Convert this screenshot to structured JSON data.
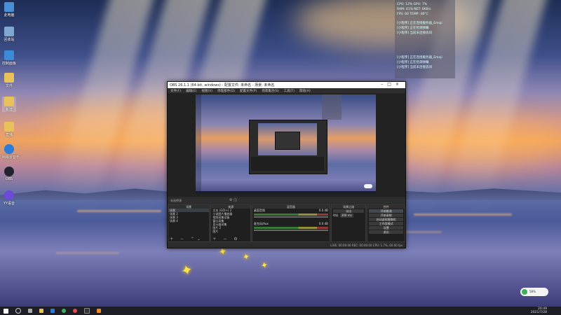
{
  "desktop": {
    "icons": [
      {
        "label": "此电脑",
        "color": "#4a8fd6"
      },
      {
        "label": "回收站",
        "color": "#7fa7cf"
      },
      {
        "label": "控制面板",
        "color": "#3d8ad8"
      },
      {
        "label": "文件",
        "color": "#e8c15a"
      },
      {
        "label": "新建",
        "color": "#e8c15a"
      },
      {
        "label": "直播",
        "color": "#e8c15a"
      },
      {
        "label": "网易云音乐",
        "color": "#2b7bd8"
      },
      {
        "label": "OBS",
        "color": "#222233"
      },
      {
        "label": "YY语音",
        "color": "#6b4bd8"
      }
    ]
  },
  "monitor": {
    "rows": [
      "CPU: 12%  GPU: 7%",
      "RAM: 41%  NET: 6KB/s",
      "FPS: 60  TEMP: 48°C",
      "[小程序] 正在连接服务器_Emoji",
      "[小程序] 正在检测弹幕",
      "[小程序] 当前未连接房间",
      "[小程序] 正在连接服务器_Emoji",
      "[小程序] 正在检测弹幕",
      "[小程序] 当前未连接房间"
    ]
  },
  "obs": {
    "title": "OBS 26.1.1 (64-bit, windows) - 配置文件: 未命名 - 场景: 未命名",
    "menu": [
      "文件(F)",
      "编辑(E)",
      "视图(V)",
      "停靠部件(D)",
      "配置文件(P)",
      "场景集合(S)",
      "工具(T)",
      "帮助(H)"
    ],
    "scene_bar": "未选择源",
    "scenes": {
      "header": "场景",
      "items": [
        "场景",
        "场景 2",
        "场景 3",
        "场景 4"
      ]
    },
    "sources": {
      "header": "来源",
      "items": [
        "文本 (GDI+) 2",
        "小说图片播放器",
        "视频采集设备",
        "窗口采集",
        "显示器采集",
        "图片 2",
        "图片"
      ]
    },
    "mixer": {
      "header": "混音器",
      "tracks": [
        {
          "name": "桌面音频",
          "db": "0.0 dB"
        },
        {
          "name": "麦克风/Aux",
          "db": "0.0 dB"
        }
      ]
    },
    "transitions": {
      "header": "场景过渡",
      "type": "淡出",
      "duration_label": "时长",
      "duration": "300 ms"
    },
    "controls": {
      "header": "控件",
      "buttons": [
        "开始推流",
        "开始录制",
        "启动虚拟摄像机",
        "工作室模式",
        "设置",
        "退出"
      ]
    },
    "status": "LIVE: 00:00:00   REC: 00:00:00   CPU: 1.7%, 60.00 fps"
  },
  "taskbar": {
    "time": "20:49",
    "date": "2021/7/28"
  },
  "badge": {
    "text": "58%"
  },
  "colors": {
    "accent": "#3a8a3a"
  }
}
